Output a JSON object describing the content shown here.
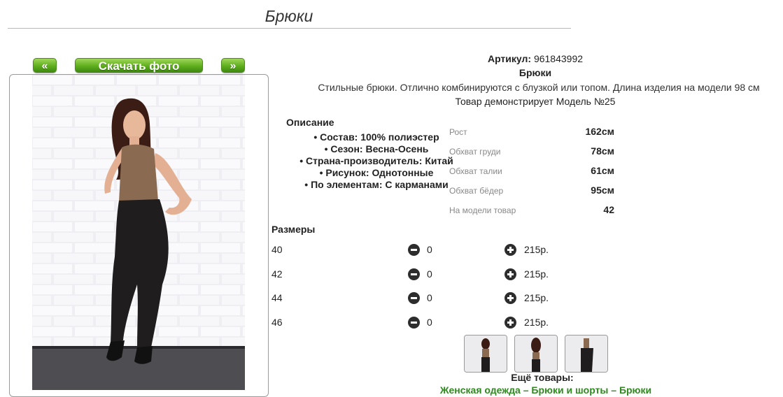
{
  "page": {
    "title": "Брюки"
  },
  "buttons": {
    "prev": "«",
    "download": "Скачать фото",
    "next": "»"
  },
  "product": {
    "article_label": "Артикул:",
    "article": "961843992",
    "name": "Брюки",
    "description": "Стильные брюки. Отлично комбинируются с блузкой или топом. Длина изделия на модели 98 см",
    "model_note": "Товар демонстрирует Модель №25"
  },
  "description": {
    "heading": "Описание",
    "features": [
      "Состав: 100% полиэстер",
      "Сезон: Весна-Осень",
      "Страна-производитель: Китай",
      "Рисунок: Однотонные",
      "По элементам: С карманами"
    ]
  },
  "measurements": [
    {
      "label": "Рост",
      "value": "162см"
    },
    {
      "label": "Обхват груди",
      "value": "78см"
    },
    {
      "label": "Обхват талии",
      "value": "61см"
    },
    {
      "label": "Обхват бёдер",
      "value": "95см"
    },
    {
      "label": "На модели товар",
      "value": "42"
    }
  ],
  "sizes": {
    "heading": "Размеры",
    "rows": [
      {
        "size": "40",
        "qty": "0",
        "price": "215р."
      },
      {
        "size": "42",
        "qty": "0",
        "price": "215р."
      },
      {
        "size": "44",
        "qty": "0",
        "price": "215р."
      },
      {
        "size": "46",
        "qty": "0",
        "price": "215р."
      }
    ]
  },
  "more": {
    "heading": "Ещё товары:",
    "links": "Женская одежда – Брюки и шорты – Брюки"
  },
  "colors": {
    "accent_green": "#5fae1e",
    "link_green": "#2e8a1e"
  },
  "icons": {
    "minus": "minus-circle-icon",
    "plus": "plus-circle-icon"
  }
}
